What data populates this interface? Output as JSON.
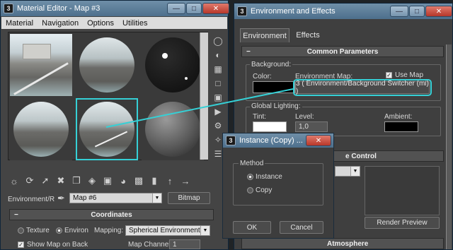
{
  "material_editor": {
    "title": "Material Editor - Map #3",
    "menu": [
      "Material",
      "Navigation",
      "Options",
      "Utilities"
    ],
    "slot_label": "Environment/R",
    "map_name": "Map #6",
    "map_type": "Bitmap",
    "coordinates": {
      "header": "Coordinates",
      "texture_label": "Texture",
      "environ_label": "Environ",
      "mapping_label": "Mapping:",
      "mapping_value": "Spherical Environment",
      "show_map_label": "Show Map on Back",
      "map_channel_label": "Map Channel:",
      "map_channel_value": "1"
    }
  },
  "env_effects": {
    "title": "Environment and Effects",
    "tabs": [
      "Environment",
      "Effects"
    ],
    "common_header": "Common Parameters",
    "background_label": "Background:",
    "color_label": "Color:",
    "env_map_label": "Environment Map:",
    "use_map_label": "Use Map",
    "env_map_value": "3  ( Environment/Background Switcher (mi) )",
    "global_lighting_label": "Global Lighting:",
    "tint_label": "Tint:",
    "level_label": "Level:",
    "level_value": "1,0",
    "ambient_label": "Ambient:",
    "exposure_partial": "e Control",
    "render_preview_label": "Render Preview",
    "atmosphere_partial": "Atmosphere",
    "colors": {
      "background": "#000000",
      "tint": "#ffffff",
      "ambient": "#000000"
    }
  },
  "instance_dialog": {
    "title": "Instance (Copy) ...",
    "method_label": "Method",
    "options": [
      "Instance",
      "Copy"
    ],
    "selected": "Instance",
    "ok_label": "OK",
    "cancel_label": "Cancel"
  },
  "colors": {
    "highlight": "#35d0d6",
    "title_blue": "#5a7c98"
  }
}
